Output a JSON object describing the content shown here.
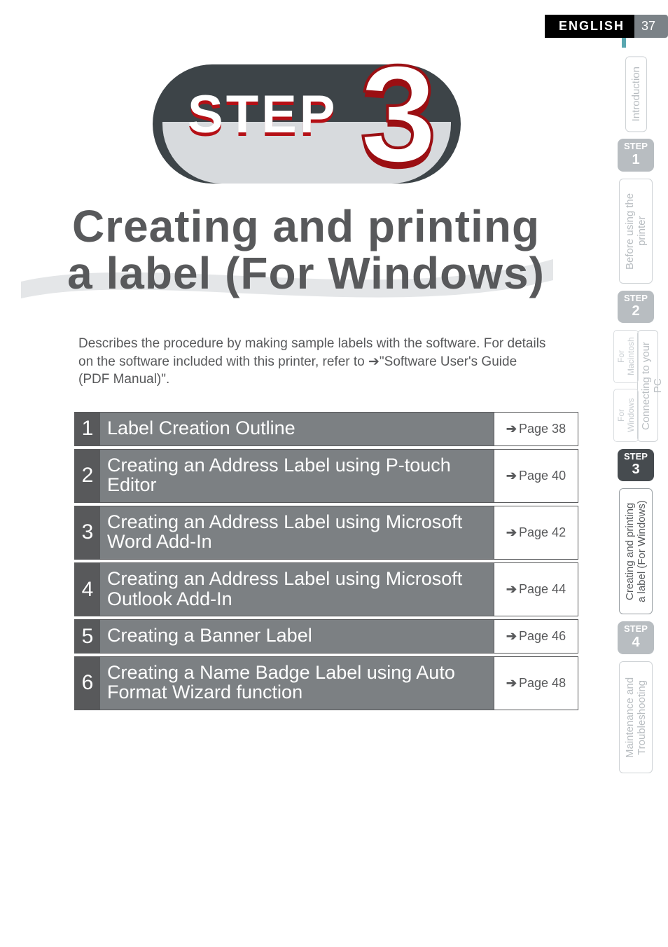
{
  "header": {
    "language": "ENGLISH",
    "page_number": "37"
  },
  "step_badge": {
    "label": "STEP",
    "number": "3"
  },
  "headline": {
    "line1": "Creating and printing",
    "line2": "a label (For Windows)"
  },
  "description": "Describes the procedure by making sample labels with the software. For details on the software included with this printer, refer to ➔\"Software User's Guide (PDF Manual)\".",
  "toc": [
    {
      "num": "1",
      "title": "Label Creation Outline",
      "page": "Page 38"
    },
    {
      "num": "2",
      "title": "Creating an Address Label using P-touch Editor",
      "page": "Page 40"
    },
    {
      "num": "3",
      "title": "Creating an Address Label using Microsoft Word Add-In",
      "page": "Page 42"
    },
    {
      "num": "4",
      "title": "Creating an Address Label using Microsoft Outlook Add-In",
      "page": "Page 44"
    },
    {
      "num": "5",
      "title": "Creating a Banner Label",
      "page": "Page 46"
    },
    {
      "num": "6",
      "title": "Creating a Name Badge Label using Auto Format Wizard function",
      "page": "Page 48"
    }
  ],
  "side_tabs": {
    "intro": "Introduction",
    "step1": {
      "label": "STEP",
      "n": "1"
    },
    "before": "Before using the printer",
    "step2": {
      "label": "STEP",
      "n": "2"
    },
    "connecting": "Connecting to your PC",
    "sub_mac": "For Macintosh",
    "sub_win": "For Windows",
    "step3": {
      "label": "STEP",
      "n": "3"
    },
    "creating": "Creating and printing a label (For Windows)",
    "step4": {
      "label": "STEP",
      "n": "4"
    },
    "maintenance": "Maintenance and Troubleshooting"
  }
}
